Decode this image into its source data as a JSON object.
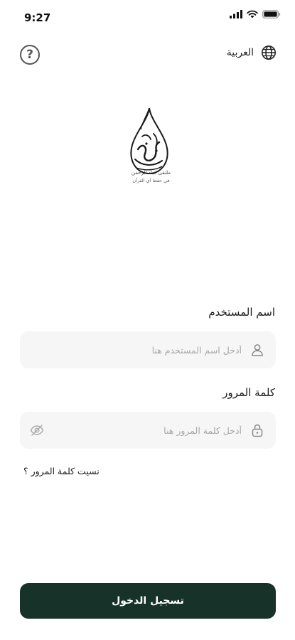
{
  "status_bar": {
    "time": "9:27"
  },
  "header": {
    "language_label": "العربية",
    "help_symbol": "?"
  },
  "logo": {
    "line1": "ملتقى عباد الرحمن",
    "line2": "في حفظ آي القرآن"
  },
  "form": {
    "username": {
      "label": "اسم المستخدم",
      "placeholder": "أدخل اسم المستخدم هنا",
      "value": ""
    },
    "password": {
      "label": "كلمة المرور",
      "placeholder": "أدخل كلمة المرور هنا",
      "value": ""
    },
    "forgot_password": "نسيت كلمة المرور ؟",
    "submit_label": "تسجيل الدخول"
  },
  "colors": {
    "primary": "#173329",
    "field_bg": "#f6f6f6",
    "placeholder": "#a8a8a8"
  },
  "icons": [
    "signal-icon",
    "wifi-icon",
    "battery-icon",
    "help-icon",
    "globe-icon",
    "user-icon",
    "lock-icon",
    "eye-off-icon"
  ]
}
